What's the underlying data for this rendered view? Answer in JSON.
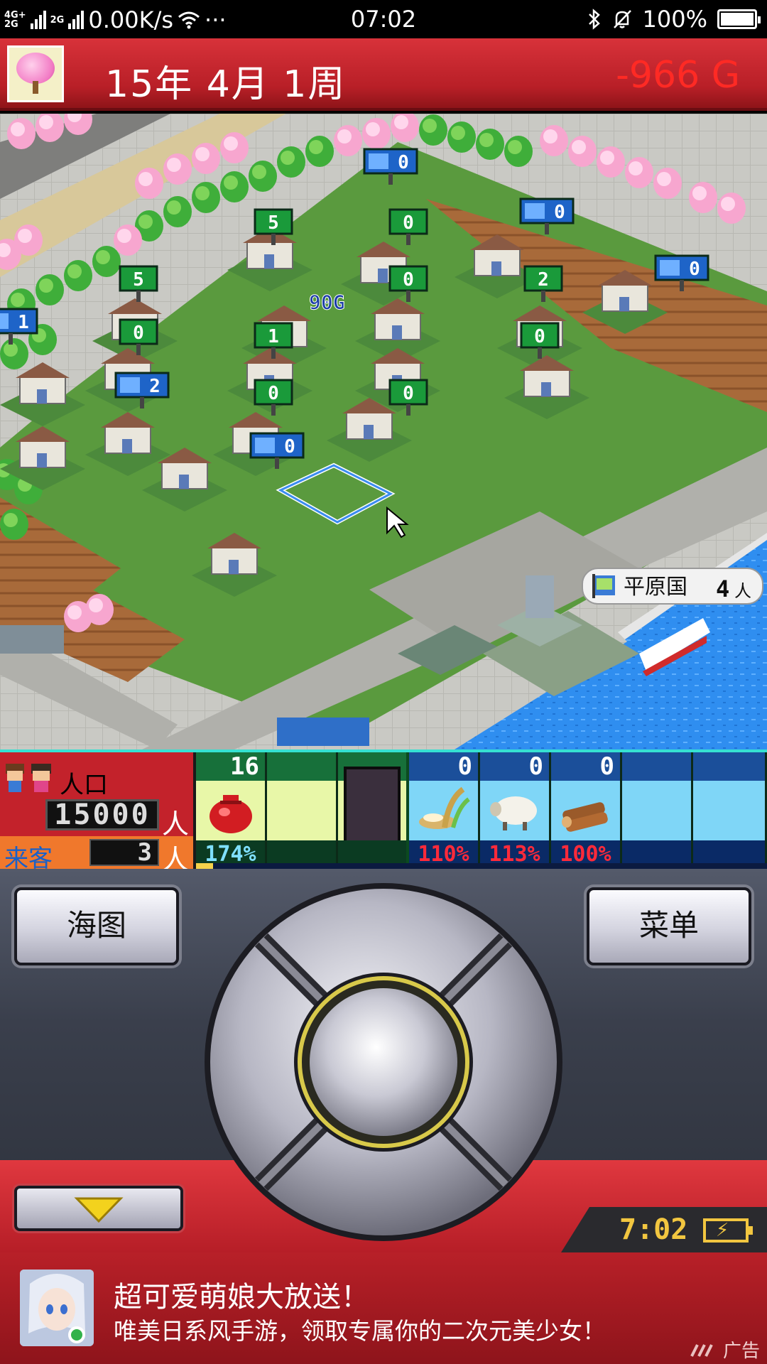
{
  "status_bar": {
    "network_label": "4G+\n2G",
    "network_label_2": "2G",
    "speed": "0.00K/s",
    "more": "···",
    "time": "07:02",
    "battery": "100%"
  },
  "header": {
    "date": "15年  4月 1周",
    "money": "-966 G",
    "avatar_icon": "cherry-blossom-tree-icon"
  },
  "map": {
    "building_labels": [
      "5",
      "0",
      "0",
      "0",
      "5",
      "0",
      "2",
      "0",
      "0",
      "1",
      "0",
      "1",
      "0",
      "2",
      "0",
      "0"
    ],
    "income_popup": "90G",
    "port_name": "平原国",
    "port_count": "4",
    "port_unit": "人"
  },
  "hud": {
    "population_label": "人口",
    "population_value": "15000",
    "population_unit": "人",
    "visitor_label": "来客",
    "visitor_value": "3",
    "visitor_unit": "人",
    "progress_fraction": 0.03,
    "slots": [
      {
        "kind": "green",
        "count": "16",
        "percent": "174%",
        "icon": "money-bag-icon"
      },
      {
        "kind": "green",
        "count": "",
        "percent": "",
        "icon": ""
      },
      {
        "kind": "green-dark",
        "count": "",
        "percent": "",
        "icon": ""
      },
      {
        "kind": "blue",
        "count": "0",
        "percent": "110%",
        "icon": "rice-icon"
      },
      {
        "kind": "blue",
        "count": "0",
        "percent": "113%",
        "icon": "sheep-icon"
      },
      {
        "kind": "blue",
        "count": "0",
        "percent": "100%",
        "icon": "lumber-icon"
      },
      {
        "kind": "blue",
        "count": "",
        "percent": "",
        "icon": ""
      },
      {
        "kind": "blue",
        "count": "",
        "percent": "",
        "icon": ""
      }
    ]
  },
  "controls": {
    "seamap_label": "海图",
    "menu_label": "菜单",
    "clock": "7:02"
  },
  "ad": {
    "title": "超可爱萌娘大放送！",
    "description": "唯美日系风手游，领取专属你的二次元美少女！",
    "tag": "广告"
  },
  "colors": {
    "header_red": "#c3222b",
    "money_red": "#ff2a24",
    "hud_green": "#17703a",
    "hud_blue": "#1b4f9a",
    "percent_red": "#ff2a3a",
    "percent_cyan": "#7fe0ff",
    "sea_blue": "#2f8ef0"
  }
}
